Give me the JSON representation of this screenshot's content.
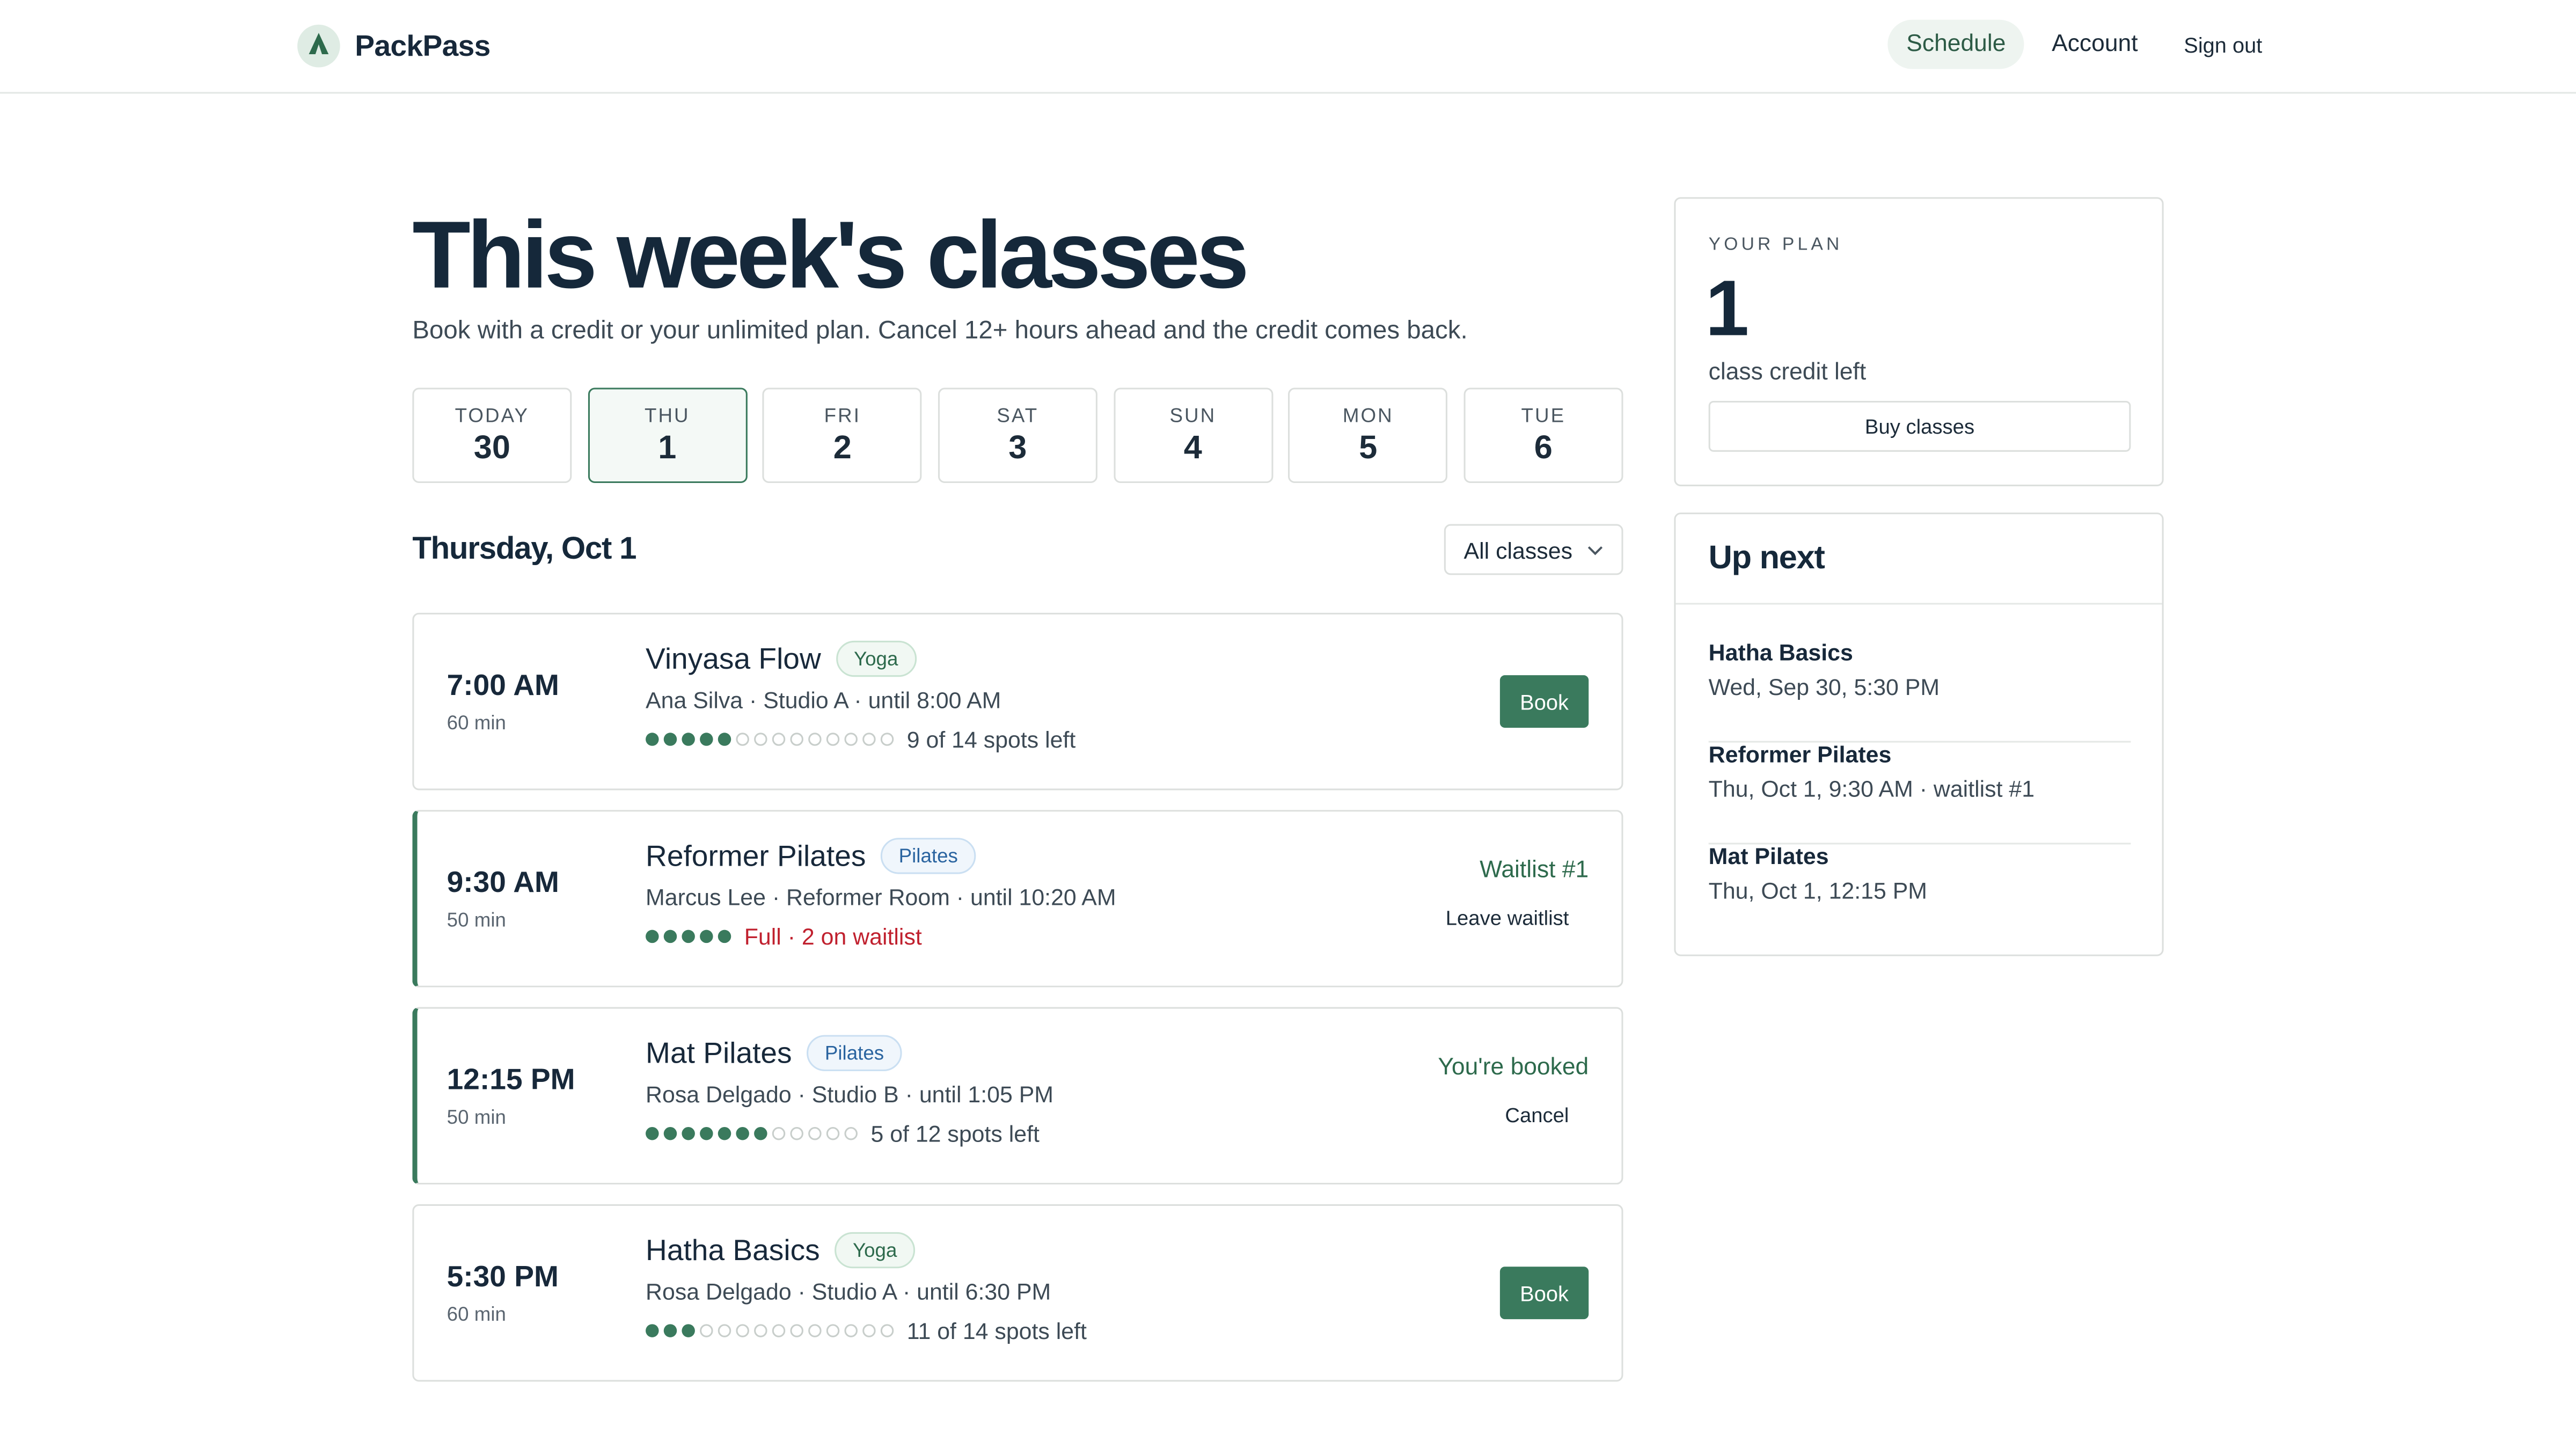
{
  "app": {
    "name": "PackPass"
  },
  "nav": {
    "schedule": "Schedule",
    "account": "Account",
    "sign_out": "Sign out"
  },
  "page": {
    "title": "This week's classes",
    "subtitle": "Book with a credit or your unlimited plan. Cancel 12+ hours ahead and the credit comes back."
  },
  "days": [
    {
      "name": "TODAY",
      "num": "30",
      "selected": false
    },
    {
      "name": "THU",
      "num": "1",
      "selected": true
    },
    {
      "name": "FRI",
      "num": "2",
      "selected": false
    },
    {
      "name": "SAT",
      "num": "3",
      "selected": false
    },
    {
      "name": "SUN",
      "num": "4",
      "selected": false
    },
    {
      "name": "MON",
      "num": "5",
      "selected": false
    },
    {
      "name": "TUE",
      "num": "6",
      "selected": false
    }
  ],
  "schedule": {
    "date_heading": "Thursday, Oct 1",
    "filter_label": "All classes"
  },
  "classes": [
    {
      "time": "7:00 AM",
      "duration": "60 min",
      "name": "Vinyasa Flow",
      "tag": "Yoga",
      "tag_type": "yoga",
      "meta": "Ana Silva · Studio A · until 8:00 AM",
      "filled": 5,
      "capacity": 14,
      "spots": "9 of 14 spots left",
      "full": false,
      "action": "book",
      "book_label": "Book"
    },
    {
      "time": "9:30 AM",
      "duration": "50 min",
      "name": "Reformer Pilates",
      "tag": "Pilates",
      "tag_type": "pilates",
      "meta": "Marcus Lee · Reformer Room · until 10:20 AM",
      "filled": 5,
      "capacity": 5,
      "spots": "Full · 2 on waitlist",
      "full": true,
      "action": "waitlist",
      "status_label": "Waitlist #1",
      "secondary_label": "Leave waitlist"
    },
    {
      "time": "12:15 PM",
      "duration": "50 min",
      "name": "Mat Pilates",
      "tag": "Pilates",
      "tag_type": "pilates",
      "meta": "Rosa Delgado · Studio B · until 1:05 PM",
      "filled": 7,
      "capacity": 12,
      "spots": "5 of 12 spots left",
      "full": false,
      "action": "booked",
      "status_label": "You're booked",
      "secondary_label": "Cancel"
    },
    {
      "time": "5:30 PM",
      "duration": "60 min",
      "name": "Hatha Basics",
      "tag": "Yoga",
      "tag_type": "yoga",
      "meta": "Rosa Delgado · Studio A · until 6:30 PM",
      "filled": 3,
      "capacity": 14,
      "spots": "11 of 14 spots left",
      "full": false,
      "action": "book",
      "book_label": "Book"
    }
  ],
  "plan": {
    "label": "YOUR PLAN",
    "credits": "1",
    "credits_text": "class credit left",
    "buy_label": "Buy classes"
  },
  "up_next": {
    "title": "Up next",
    "items": [
      {
        "name": "Hatha Basics",
        "when": "Wed, Sep 30, 5:30 PM"
      },
      {
        "name": "Reformer Pilates",
        "when": "Thu, Oct 1, 9:30 AM · waitlist #1"
      },
      {
        "name": "Mat Pilates",
        "when": "Thu, Oct 1, 12:15 PM"
      }
    ]
  },
  "colors": {
    "accent": "#3a7a5d",
    "full": "#c0202e",
    "text": "#15283a"
  },
  "icons": {
    "brand": "tent-icon",
    "filter": "chevron-down-icon"
  }
}
